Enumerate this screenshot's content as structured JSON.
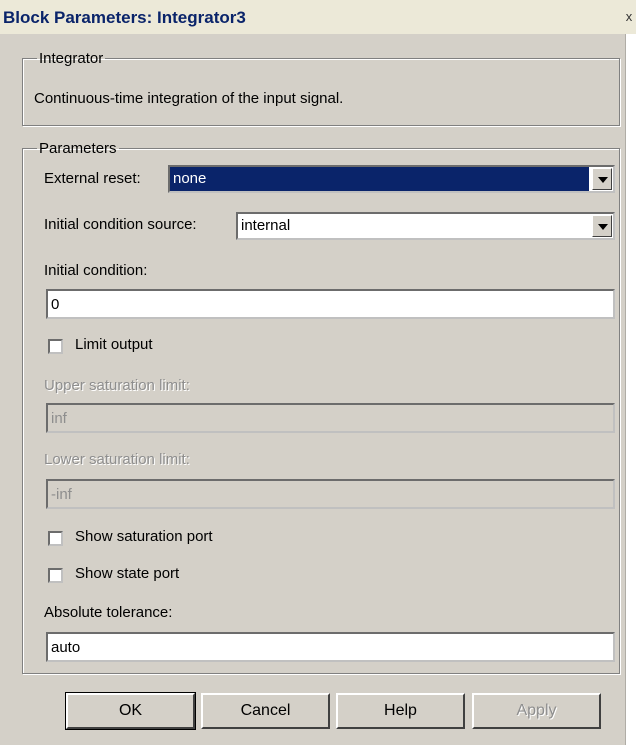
{
  "window": {
    "title": "Block Parameters: Integrator3",
    "close_glyph": "x"
  },
  "description_group": {
    "legend": "Integrator",
    "text": "Continuous-time integration of the input signal."
  },
  "parameters_group": {
    "legend": "Parameters",
    "external_reset": {
      "label": "External reset:",
      "value": "none"
    },
    "initial_condition_source": {
      "label": "Initial condition source:",
      "value": "internal"
    },
    "initial_condition": {
      "label": "Initial condition:",
      "value": "0"
    },
    "limit_output": {
      "label": "Limit output",
      "checked": false
    },
    "upper_saturation_limit": {
      "label": "Upper saturation limit:",
      "value": "inf",
      "enabled": false
    },
    "lower_saturation_limit": {
      "label": "Lower saturation limit:",
      "value": "-inf",
      "enabled": false
    },
    "show_saturation_port": {
      "label": "Show saturation port",
      "checked": false
    },
    "show_state_port": {
      "label": "Show state port",
      "checked": false
    },
    "absolute_tolerance": {
      "label": "Absolute tolerance:",
      "value": "auto"
    }
  },
  "buttons": {
    "ok": "OK",
    "cancel": "Cancel",
    "help": "Help",
    "apply": "Apply"
  },
  "colors": {
    "dialog_bg": "#d4d0c8",
    "title_text": "#0a246a",
    "selection": "#0a246a"
  }
}
